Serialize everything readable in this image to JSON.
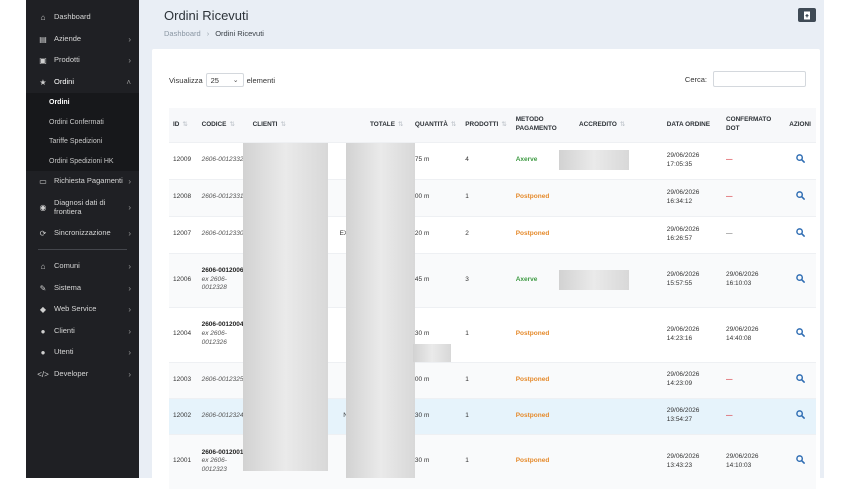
{
  "sidebar": {
    "items": [
      {
        "label": "Dashboard",
        "icon": "dashboard-icon",
        "glyph": "⌂",
        "chevron": ""
      },
      {
        "label": "Aziende",
        "icon": "chart-icon",
        "glyph": "▤",
        "chevron": "›"
      },
      {
        "label": "Prodotti",
        "icon": "product-icon",
        "glyph": "▣",
        "chevron": "›"
      },
      {
        "label": "Ordini",
        "icon": "star-icon",
        "glyph": "★",
        "chevron": "˄"
      }
    ],
    "sub_items": [
      {
        "label": "Ordini"
      },
      {
        "label": "Ordini Confermati"
      },
      {
        "label": "Tariffe Spedizioni"
      },
      {
        "label": "Ordini Spedizioni HK"
      }
    ],
    "items_after": [
      {
        "label": "Richiesta Pagamenti",
        "icon": "card-icon",
        "glyph": "▭",
        "chevron": "›"
      },
      {
        "label": "Diagnosi dati di frontiera",
        "icon": "eye-icon",
        "glyph": "◉",
        "chevron": "›"
      },
      {
        "label": "Sincronizzazione",
        "icon": "sync-icon",
        "glyph": "⟳",
        "chevron": "›"
      }
    ],
    "items_bottom": [
      {
        "label": "Comuni",
        "icon": "building-icon",
        "glyph": "⌂",
        "chevron": "›"
      },
      {
        "label": "Sistema",
        "icon": "wrench-icon",
        "glyph": "✎",
        "chevron": "›"
      },
      {
        "label": "Web Service",
        "icon": "shield-icon",
        "glyph": "◆",
        "chevron": "›"
      },
      {
        "label": "Clienti",
        "icon": "user-icon",
        "glyph": "●",
        "chevron": "›"
      },
      {
        "label": "Utenti",
        "icon": "users-icon",
        "glyph": "●",
        "chevron": "›"
      },
      {
        "label": "Developer",
        "icon": "code-icon",
        "glyph": "</>",
        "chevron": "›"
      }
    ]
  },
  "header": {
    "title": "Ordini Ricevuti",
    "breadcrumb_home": "Dashboard",
    "breadcrumb_sep": "›",
    "breadcrumb_current": "Ordini Ricevuti",
    "export_icon": "export-icon"
  },
  "controls": {
    "show_label": "Visualizza",
    "page_size": "25",
    "elements_label": "elementi",
    "search_label": "Cerca:",
    "search_value": ""
  },
  "table": {
    "columns": [
      "ID",
      "CODICE",
      "CLIENTI",
      "TOTALE",
      "QUANTITÀ",
      "PRODOTTI",
      "METODO PAGAMENTO",
      "ACCREDITO",
      "DATA ORDINE",
      "CONFERMATO DOT",
      "AZIONI"
    ],
    "rows": [
      {
        "id": "12009",
        "code": "2606-0012332",
        "code_bold": "",
        "code_ex": "",
        "cliente": "",
        "qty": "75 m",
        "prodotti": "4",
        "metodo": "Axerve",
        "data": "29/06/2026 17:05:35",
        "conf": "—",
        "conf_style": "red"
      },
      {
        "id": "12008",
        "code": "2606-0012331",
        "code_bold": "",
        "code_ex": "",
        "cliente": "",
        "qty": "00 m",
        "prodotti": "1",
        "metodo": "Postponed",
        "data": "29/06/2026 16:34:12",
        "conf": "—",
        "conf_style": "red"
      },
      {
        "id": "12007",
        "code": "2606-0012330",
        "code_bold": "",
        "code_ex": "",
        "cliente": "EXTILE",
        "qty": "20 m",
        "prodotti": "2",
        "metodo": "Postponed",
        "data": "29/06/2026 16:26:57",
        "conf": "—",
        "conf_style": "gray"
      },
      {
        "id": "12006",
        "code": "",
        "code_bold": "2606-0012006",
        "code_ex": "ex 2606-0012328",
        "cliente": "",
        "qty": "45 m",
        "prodotti": "3",
        "metodo": "Axerve",
        "data": "29/06/2026 15:57:55",
        "conf": "29/06/2026 16:10:03",
        "conf_style": "text"
      },
      {
        "id": "12004",
        "code": "",
        "code_bold": "2606-0012004",
        "code_ex": "ex 2606-0012326",
        "cliente": "",
        "qty": "30 m",
        "prodotti": "1",
        "metodo": "Postponed",
        "data": "29/06/2026 14:23:16",
        "conf": "29/06/2026 14:40:08",
        "conf_style": "text"
      },
      {
        "id": "12003",
        "code": "2606-0012325",
        "code_bold": "",
        "code_ex": "",
        "cliente": "",
        "qty": "00 m",
        "prodotti": "1",
        "metodo": "Postponed",
        "data": "29/06/2026 14:23:09",
        "conf": "—",
        "conf_style": "red"
      },
      {
        "id": "12002",
        "code": "2606-0012324",
        "code_bold": "",
        "code_ex": "",
        "cliente": "NG LL",
        "qty": "30 m",
        "prodotti": "1",
        "metodo": "Postponed",
        "data": "29/06/2026 13:54:27",
        "conf": "—",
        "conf_style": "red"
      },
      {
        "id": "12001",
        "code": "",
        "code_bold": "2606-0012001",
        "code_ex": "ex 2606-0012323",
        "cliente": "",
        "qty": "30 m",
        "prodotti": "1",
        "metodo": "Postponed",
        "data": "29/06/2026 13:43:23",
        "conf": "29/06/2026 14:10:03",
        "conf_style": "text"
      }
    ]
  },
  "colors": {
    "sidebar_bg": "#1f2024",
    "axerve": "#3f9b44",
    "postponed": "#e58a2b",
    "dash_red": "#d9424a",
    "action_icon": "#2f6db3"
  }
}
